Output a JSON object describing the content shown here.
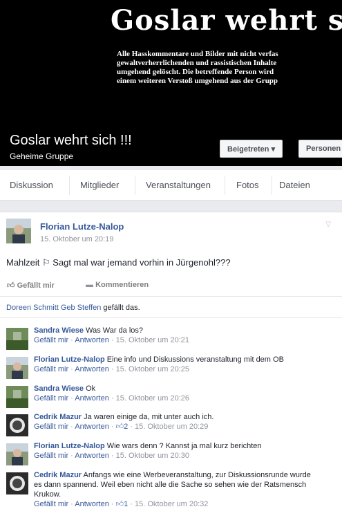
{
  "cover": {
    "title": "Goslar wehrt s",
    "text_lines": [
      "Alle Hasskommentare und Bilder mit nicht verfas",
      "gewaltverherrlichenden und rassistischen Inhalte",
      "umgehend gelöscht. Die betreffende Person wird",
      "einem weiteren Verstoß umgehend aus der Grupp"
    ]
  },
  "group": {
    "name": "Goslar wehrt sich !!!",
    "subtitle": "Geheime Gruppe",
    "joined_label": "Beigetreten ▾",
    "people_label": "Personen"
  },
  "tabs": [
    "Diskussion",
    "Mitglieder",
    "Veranstaltungen",
    "Fotos",
    "Dateien"
  ],
  "post": {
    "author": "Florian Lutze-Nalop",
    "time": "15. Oktober um 20:19",
    "text": "Mahlzeit ⚐ Sagt mal war jemand vorhin in Jürgenohl???",
    "like_label": "Gefällt mir",
    "comment_label": "Kommentieren",
    "liked_by_name": "Doreen Schmitt Geb Steffen",
    "liked_by_suffix": " gefällt das."
  },
  "comments": [
    {
      "author": "Sandra Wiese",
      "text": "Was War da los?",
      "like": "Gefällt mir",
      "reply": "Antworten",
      "likes": "",
      "time": "15. Oktober um 20:21"
    },
    {
      "author": "Florian Lutze-Nalop",
      "text": "Eine info und Diskussions veranstaltung mit dem OB",
      "like": "Gefällt mir",
      "reply": "Antworten",
      "likes": "",
      "time": "15. Oktober um 20:25"
    },
    {
      "author": "Sandra Wiese",
      "text": "Ok",
      "like": "Gefällt mir",
      "reply": "Antworten",
      "likes": "",
      "time": "15. Oktober um 20:26"
    },
    {
      "author": "Cedrik Mazur",
      "text": "Ja waren einige da, mit unter auch ich.",
      "like": "Gefällt mir",
      "reply": "Antworten",
      "likes": "2",
      "time": "15. Oktober um 20:29"
    },
    {
      "author": "Florian Lutze-Nalop",
      "text": "Wie wars denn ? Kannst ja mal kurz berichten",
      "like": "Gefällt mir",
      "reply": "Antworten",
      "likes": "",
      "time": "15. Oktober um 20:30"
    },
    {
      "author": "Cedrik Mazur",
      "text": "Anfangs wie eine Werbeveranstaltung, zur Diskussionsrunde wurde es dann spannend. Weil eben nicht alle die Sache so sehen wie der Ratsmensch Krukow.",
      "like": "Gefällt mir",
      "reply": "Antworten",
      "likes": "1",
      "time": "15. Oktober um 20:32"
    }
  ]
}
